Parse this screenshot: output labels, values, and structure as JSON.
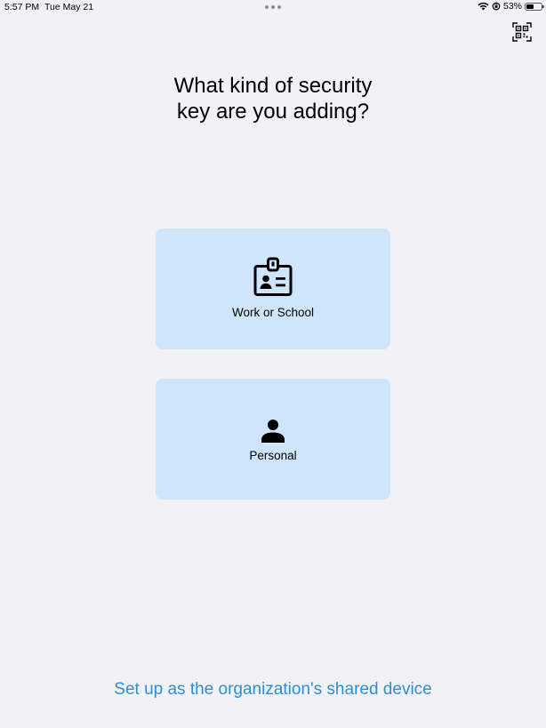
{
  "status_bar": {
    "time": "5:57 PM",
    "date": "Tue May 21",
    "battery_percent": "53%",
    "battery_level": 0.53,
    "icons": [
      "wifi-icon",
      "orientation-lock-icon",
      "battery-icon"
    ]
  },
  "header": {
    "qr_icon": "qr-scan-icon"
  },
  "main": {
    "title_line1": "What kind of security",
    "title_line2": "key are you adding?",
    "options": [
      {
        "label": "Work or School",
        "icon": "id-badge-icon"
      },
      {
        "label": "Personal",
        "icon": "person-icon"
      }
    ]
  },
  "footer": {
    "shared_device_link": "Set up as the organization's shared device"
  },
  "colors": {
    "background": "#f2f1f6",
    "card": "#cfe5fc",
    "link": "#2a8fd6"
  }
}
